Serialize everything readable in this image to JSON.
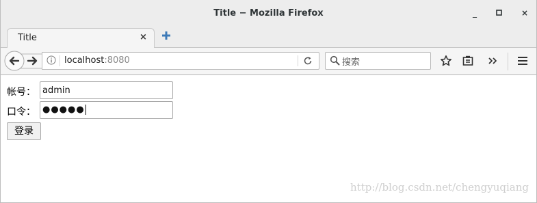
{
  "window": {
    "title": "Title − Mozilla Firefox",
    "controls": {
      "minimize": "_",
      "maximize": "□",
      "close": "×"
    }
  },
  "tab": {
    "title": "Title",
    "close": "×"
  },
  "navbar": {
    "url_host": "localhost",
    "url_port": ":8080",
    "search_placeholder": "搜索"
  },
  "form": {
    "account_label": "帐号：",
    "account_value": "admin",
    "password_label": "口令：",
    "password_value": "●●●●●",
    "login_button": "登录"
  },
  "watermark": "http://blog.csdn.net/chengyuqiang",
  "colors": {
    "accent_newtab": "#3d7ab8"
  }
}
